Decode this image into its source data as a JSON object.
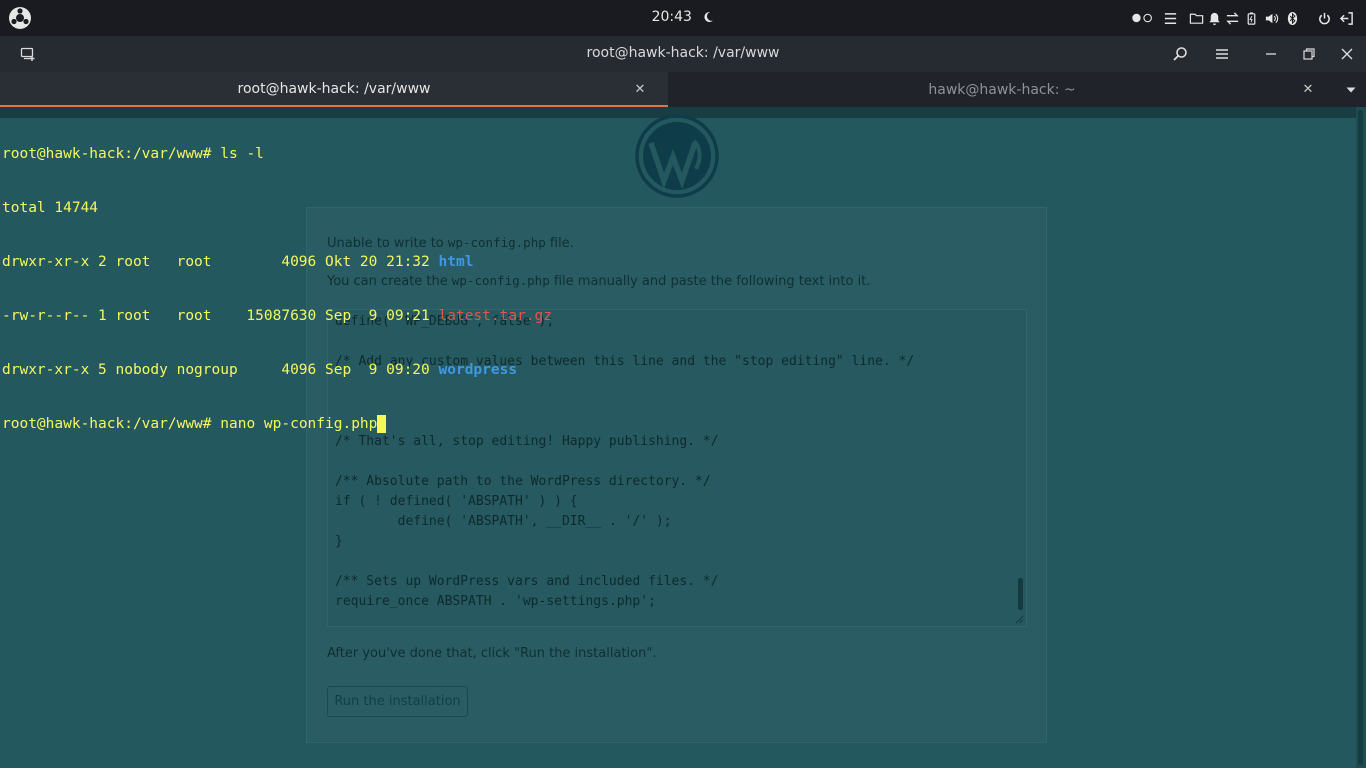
{
  "topbar": {
    "time": "20:43",
    "icons": [
      "distro-logo-icon",
      "moon-icon",
      "toggle-dots-icon",
      "list-icon",
      "folder-icon",
      "bell-icon",
      "transfer-icon",
      "battery-icon",
      "volume-icon",
      "bluetooth-icon",
      "power-icon",
      "logout-icon"
    ]
  },
  "terminal": {
    "window_title": "root@hawk-hack: /var/www",
    "tabs": [
      {
        "label": "root@hawk-hack: /var/www"
      },
      {
        "label": "hawk@hawk-hack: ~"
      }
    ],
    "lines": [
      {
        "prompt": "root@hawk-hack:/var/www# ",
        "cmd": "ls -l"
      },
      {
        "text": "total 14744"
      },
      {
        "meta": "drwxr-xr-x 2 root   root        4096 Okt 20 21:32 ",
        "name": "html"
      },
      {
        "meta": "-rw-r--r-- 1 root   root    15087630 Sep  9 09:21 ",
        "name": "latest.tar.gz"
      },
      {
        "meta": "drwxr-xr-x 5 nobody nogroup     4096 Sep  9 09:20 ",
        "name": "wordpress"
      },
      {
        "prompt": "root@hawk-hack:/var/www# ",
        "cmd": "nano wp-config.php"
      }
    ]
  },
  "webpage": {
    "unable_pre": "Unable to write to ",
    "unable_file": "wp-config.php",
    "unable_post": " file.",
    "create_pre": "You can create the ",
    "create_file": "wp-config.php",
    "create_post": " file manually and paste the following text into it.",
    "code": "define( 'WP_DEBUG', false );\n\n/* Add any custom values between this line and the \"stop editing\" line. */\n\n\n\n/* That's all, stop editing! Happy publishing. */\n\n/** Absolute path to the WordPress directory. */\nif ( ! defined( 'ABSPATH' ) ) {\n        define( 'ABSPATH', __DIR__ . '/' );\n}\n\n/** Sets up WordPress vars and included files. */\nrequire_once ABSPATH . 'wp-settings.php';",
    "after_text": "After you've done that, click \"Run the installation\".",
    "run_button": "Run the installation"
  }
}
